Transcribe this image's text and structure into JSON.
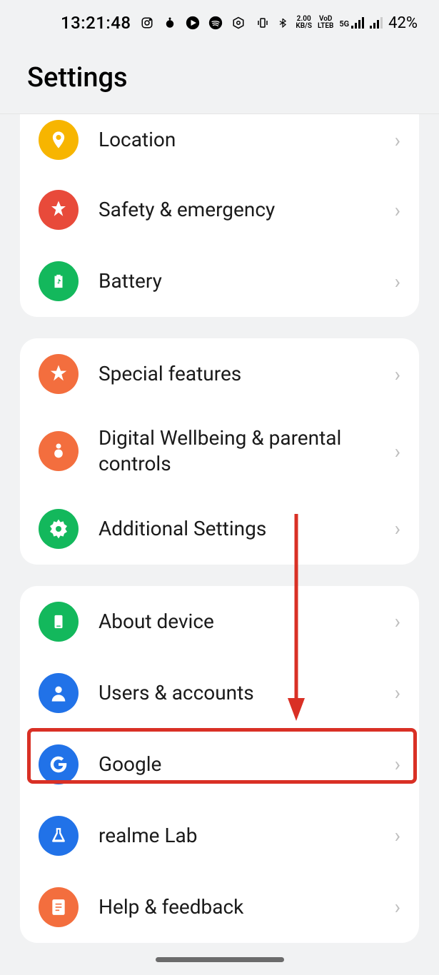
{
  "status_bar": {
    "time": "13:21:48",
    "notification_icons": [
      "instagram",
      "reddit",
      "play",
      "spotify",
      "hexagon"
    ],
    "battery_text": "42%",
    "network_speed_top": "2.00",
    "network_speed_bottom": "KB/S",
    "voice_top": "VoD",
    "voice_bottom": "LTEB",
    "signal_type": "5G"
  },
  "page": {
    "title": "Settings"
  },
  "groups": [
    {
      "items": [
        {
          "id": "location",
          "label": "Location",
          "icon_bg": "bg-yellow"
        },
        {
          "id": "safety",
          "label": "Safety & emergency",
          "icon_bg": "bg-red"
        },
        {
          "id": "battery",
          "label": "Battery",
          "icon_bg": "bg-green"
        }
      ]
    },
    {
      "items": [
        {
          "id": "special",
          "label": "Special features",
          "icon_bg": "bg-orange"
        },
        {
          "id": "wellbeing",
          "label": "Digital Wellbeing & parental controls",
          "icon_bg": "bg-orange"
        },
        {
          "id": "additional",
          "label": "Additional Settings",
          "icon_bg": "bg-green"
        }
      ]
    },
    {
      "items": [
        {
          "id": "about",
          "label": "About device",
          "icon_bg": "bg-green"
        },
        {
          "id": "users",
          "label": "Users & accounts",
          "icon_bg": "bg-blue"
        },
        {
          "id": "google",
          "label": "Google",
          "icon_bg": "bg-blue"
        },
        {
          "id": "realmelab",
          "label": "realme Lab",
          "icon_bg": "bg-blue"
        },
        {
          "id": "help",
          "label": "Help & feedback",
          "icon_bg": "bg-orange"
        }
      ]
    }
  ],
  "annotation": {
    "highlight_item": "google",
    "arrow_points_to": "google"
  }
}
